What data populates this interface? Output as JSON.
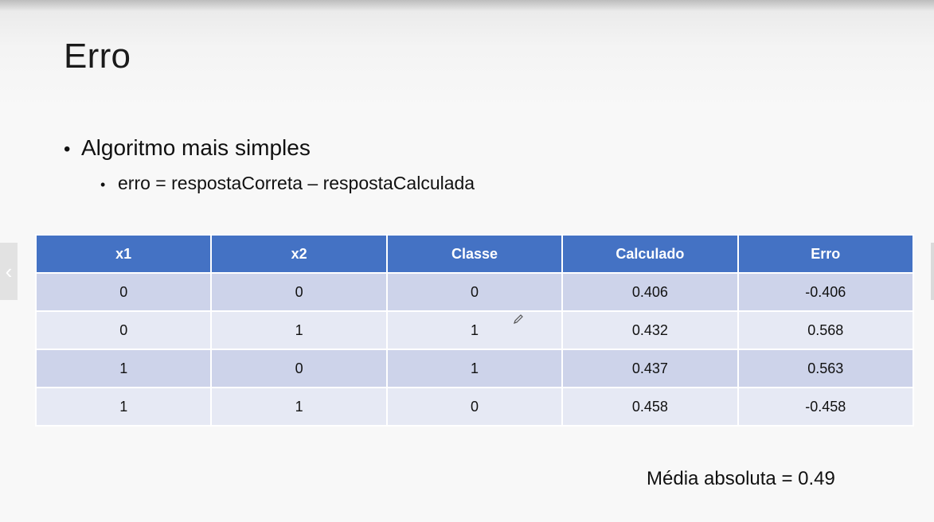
{
  "slide": {
    "title": "Erro",
    "bullet1": "Algoritmo mais simples",
    "bullet2": "erro = respostaCorreta – respostaCalculada",
    "bullet_glyph": "•"
  },
  "table": {
    "headers": [
      "x1",
      "x2",
      "Classe",
      "Calculado",
      "Erro"
    ],
    "rows": [
      [
        "0",
        "0",
        "0",
        "0.406",
        "-0.406"
      ],
      [
        "0",
        "1",
        "1",
        "0.432",
        "0.568"
      ],
      [
        "1",
        "0",
        "1",
        "0.437",
        "0.563"
      ],
      [
        "1",
        "1",
        "0",
        "0.458",
        "-0.458"
      ]
    ],
    "header_color": "#4472c4",
    "row_color_odd": "#cdd3ea",
    "row_color_even": "#e6e9f4"
  },
  "summary": "Média absoluta = 0.49",
  "nav": {
    "prev_icon": "chevron-left-icon",
    "prev_glyph": "‹"
  }
}
